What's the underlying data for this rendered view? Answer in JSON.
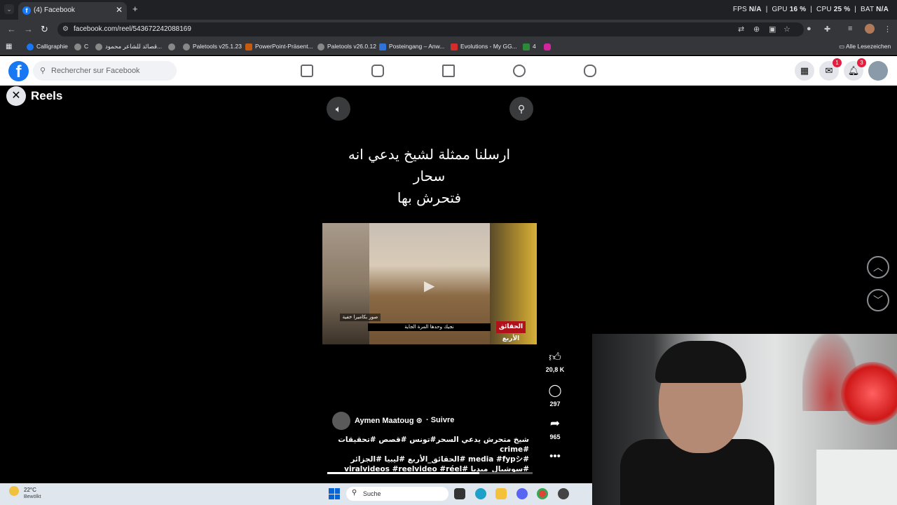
{
  "browser": {
    "tab_title": "(4) Facebook",
    "url": "facebook.com/reel/543672242088169",
    "perf": {
      "fps_label": "FPS",
      "fps_value": "N/A",
      "gpu_label": "GPU",
      "gpu_value": "16 %",
      "cpu_label": "CPU",
      "cpu_value": "25 %",
      "bat_label": "BAT",
      "bat_value": "N/A"
    },
    "bookmarks": [
      "Calligraphie",
      "C",
      "قصائد للشاعر محمود...",
      "Paletools v25.1.23",
      "PowerPoint-Präsent...",
      "Paletools v26.0.12",
      "Posteingang – Anw...",
      "Evolutions - My GG...",
      "4"
    ],
    "all_bookmarks": "Alle Lesezeichen"
  },
  "facebook": {
    "search_placeholder": "Rechercher sur Facebook",
    "messenger_badge": "1",
    "notifications_badge": "3"
  },
  "reels": {
    "title": "Reels",
    "caption_lines": [
      "ارسلنا ممثلة لشيخ يدعي انه",
      "سحار",
      "فتحرش بها"
    ],
    "video_overlays": {
      "left": "صور بكاميرا خفية",
      "bottom": "نجيك وحدها المرة الجاية",
      "logo": "الحقائق الأربع"
    },
    "likes": "20,8 K",
    "comments": "297",
    "shares": "965",
    "author": "Aymen Maatoug",
    "follow": "· Suivre",
    "description_lines": [
      "شيخ متحرش يدعي السحر#تونس #قصص #تحقيقات #crime",
      "#media #fypシ #الحقائق_الأربع #ليبيا #الجزائر",
      "#سوشيال_ميديا #viralvideos #reelvideo #réel"
    ],
    "progress": 0.74
  },
  "taskbar": {
    "weather_temp": "22°C",
    "weather_desc": "Bewölkt",
    "search": "Suche"
  },
  "colors": {
    "fb_blue": "#1877f2",
    "badge_red": "#e41e3f"
  }
}
